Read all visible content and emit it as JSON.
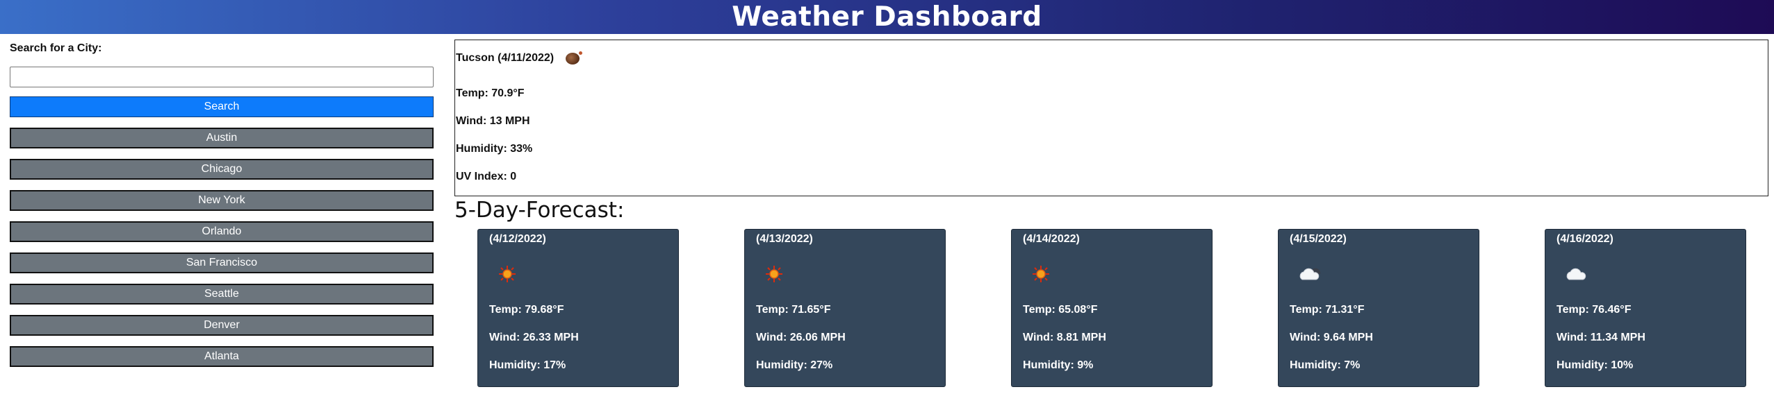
{
  "header": {
    "title": "Weather Dashboard"
  },
  "search": {
    "label": "Search for a City:",
    "input_value": "",
    "button_label": "Search"
  },
  "history": [
    {
      "label": "Austin"
    },
    {
      "label": "Chicago"
    },
    {
      "label": "New York"
    },
    {
      "label": "Orlando"
    },
    {
      "label": "San Francisco"
    },
    {
      "label": "Seattle"
    },
    {
      "label": "Denver"
    },
    {
      "label": "Atlanta"
    }
  ],
  "current": {
    "city_date": "Tucson (4/11/2022)",
    "icon": "night-clear-icon",
    "temp": "Temp: 70.9°F",
    "wind": "Wind: 13 MPH",
    "humidity": "Humidity: 33%",
    "uv": "UV Index: 0"
  },
  "forecast": {
    "title": "5-Day-Forecast:",
    "days": [
      {
        "date": "(4/12/2022)",
        "icon": "sun-icon",
        "temp": "Temp: 79.68°F",
        "wind": "Wind: 26.33 MPH",
        "humidity": "Humidity: 17%"
      },
      {
        "date": "(4/13/2022)",
        "icon": "sun-icon",
        "temp": "Temp: 71.65°F",
        "wind": "Wind: 26.06 MPH",
        "humidity": "Humidity: 27%"
      },
      {
        "date": "(4/14/2022)",
        "icon": "sun-icon",
        "temp": "Temp: 65.08°F",
        "wind": "Wind: 8.81 MPH",
        "humidity": "Humidity: 9%"
      },
      {
        "date": "(4/15/2022)",
        "icon": "cloud-icon",
        "temp": "Temp: 71.31°F",
        "wind": "Wind: 9.64 MPH",
        "humidity": "Humidity: 7%"
      },
      {
        "date": "(4/16/2022)",
        "icon": "cloud-icon",
        "temp": "Temp: 76.46°F",
        "wind": "Wind: 11.34 MPH",
        "humidity": "Humidity: 10%"
      }
    ]
  },
  "colors": {
    "search_button": "#0d7bfb",
    "history_button": "#6c757d",
    "forecast_card": "#34475b"
  }
}
